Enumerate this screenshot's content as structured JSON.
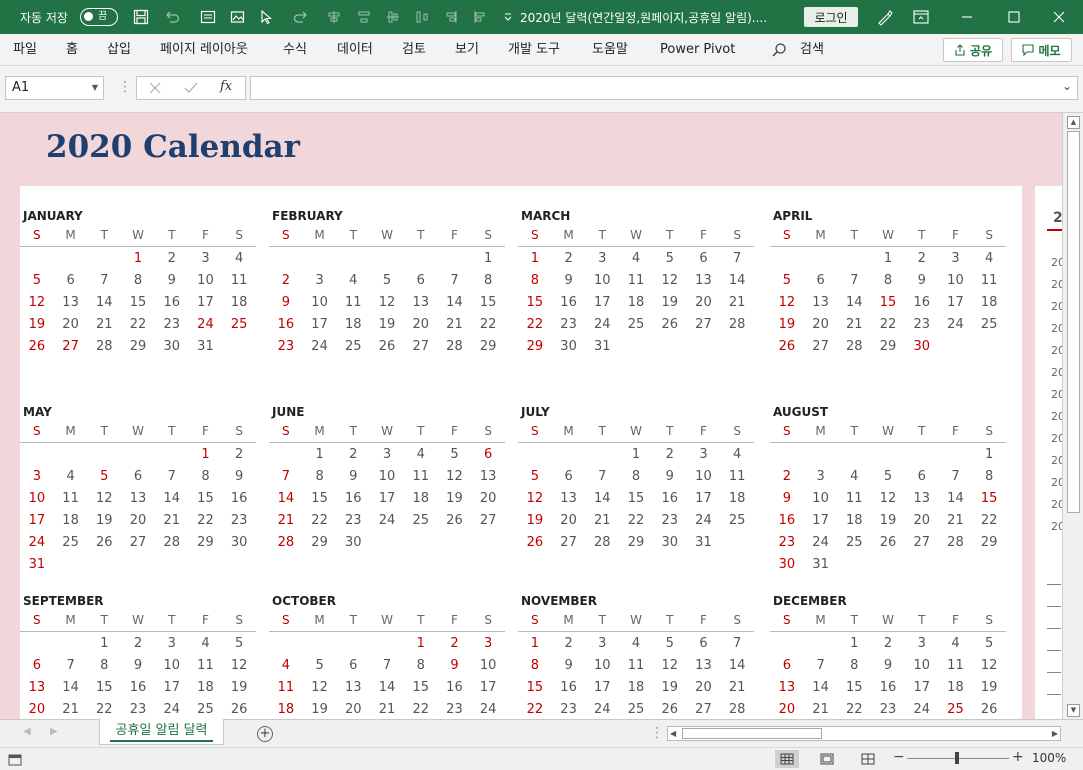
{
  "titlebar": {
    "autosave_label": "자동 저장",
    "autosave_state": "끔",
    "doc_title": "2020년 달력(연간일정,원페이지,공휴일 알림)....",
    "login_label": "로그인"
  },
  "menu": {
    "items": [
      "파일",
      "홈",
      "삽입",
      "페이지 레이아웃",
      "수식",
      "데이터",
      "검토",
      "보기",
      "개발 도구",
      "도움말",
      "Power Pivot"
    ],
    "search_label": "검색",
    "share_label": "공유",
    "comment_label": "메모"
  },
  "formula_bar": {
    "name_box": "A1",
    "formula_value": ""
  },
  "calendar": {
    "title": "2020 Calendar",
    "weekday_headers": [
      "S",
      "M",
      "T",
      "W",
      "T",
      "F",
      "S"
    ],
    "months": [
      {
        "name": "JANUARY",
        "start": 3,
        "days": 31,
        "holidays": [
          1,
          24,
          25,
          27
        ]
      },
      {
        "name": "FEBRUARY",
        "start": 6,
        "days": 29,
        "holidays": []
      },
      {
        "name": "MARCH",
        "start": 0,
        "days": 31,
        "holidays": [
          1
        ]
      },
      {
        "name": "APRIL",
        "start": 3,
        "days": 30,
        "holidays": [
          15,
          30
        ]
      },
      {
        "name": "MAY",
        "start": 5,
        "days": 31,
        "holidays": [
          1,
          5
        ]
      },
      {
        "name": "JUNE",
        "start": 1,
        "days": 30,
        "holidays": [
          6
        ]
      },
      {
        "name": "JULY",
        "start": 3,
        "days": 31,
        "holidays": []
      },
      {
        "name": "AUGUST",
        "start": 6,
        "days": 31,
        "holidays": [
          15
        ]
      },
      {
        "name": "SEPTEMBER",
        "start": 2,
        "days": 30,
        "holidays": []
      },
      {
        "name": "OCTOBER",
        "start": 4,
        "days": 31,
        "holidays": [
          1,
          2,
          3,
          9
        ]
      },
      {
        "name": "NOVEMBER",
        "start": 0,
        "days": 30,
        "holidays": []
      },
      {
        "name": "DECEMBER",
        "start": 2,
        "days": 31,
        "holidays": [
          25
        ]
      }
    ],
    "side_panel_label": "2",
    "side_panel_rows": [
      "20",
      "20",
      "20",
      "20",
      "20",
      "20",
      "20",
      "20",
      "20",
      "20",
      "20",
      "20",
      "20"
    ]
  },
  "sheet_tabs": {
    "active": "공휴일 알림 달력"
  },
  "statusbar": {
    "zoom": "100%"
  },
  "colors": {
    "excel_green": "#217346",
    "calendar_title": "#1f3f6f",
    "holiday_red": "#c00000",
    "sheet_bg": "#f1d7d9"
  }
}
